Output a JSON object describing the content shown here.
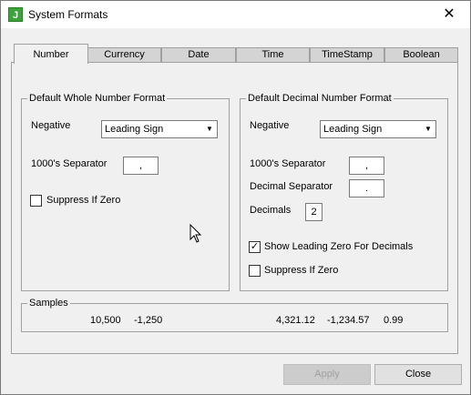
{
  "window": {
    "title": "System Formats",
    "app_icon_letter": "J",
    "close_symbol": "✕"
  },
  "tabs": [
    "Number",
    "Currency",
    "Date",
    "Time",
    "TimeStamp",
    "Boolean"
  ],
  "active_tab": "Number",
  "whole_group": {
    "title": "Default Whole Number Format",
    "negative_label": "Negative",
    "negative_value": "Leading Sign",
    "separator_label": "1000's Separator",
    "separator_value": ",",
    "suppress_label": "Suppress If Zero",
    "suppress_checked": false
  },
  "decimal_group": {
    "title": "Default Decimal Number Format",
    "negative_label": "Negative",
    "negative_value": "Leading Sign",
    "separator_label": "1000's Separator",
    "separator_value": ",",
    "decimal_separator_label": "Decimal Separator",
    "decimal_separator_value": ".",
    "decimals_label": "Decimals",
    "decimals_value": "2",
    "show_leading_zero_label": "Show Leading Zero For Decimals",
    "show_leading_zero_checked": true,
    "suppress_label": "Suppress If Zero",
    "suppress_checked": false
  },
  "samples": {
    "title": "Samples",
    "values": [
      "10,500",
      "-1,250",
      "4,321.12",
      "-1,234.57",
      "0.99"
    ]
  },
  "buttons": {
    "apply": "Apply",
    "apply_enabled": false,
    "close": "Close"
  },
  "icons": {
    "dropdown": "chevron-down-icon",
    "checkmark": "checkmark-icon",
    "cursor": "mouse-pointer-icon"
  }
}
